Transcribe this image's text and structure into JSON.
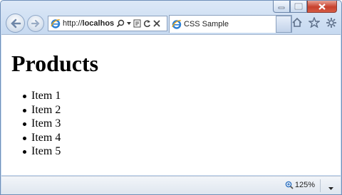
{
  "browser": {
    "address_prefix": "http://",
    "address_host": "localhost:",
    "tab_title": "CSS Sample",
    "zoom_label": "125%"
  },
  "page": {
    "heading": "Products",
    "items": [
      "Item 1",
      "Item 2",
      "Item 3",
      "Item 4",
      "Item 5"
    ]
  },
  "colors": {
    "chrome": "#c6d9f0",
    "close_button": "#c7412d",
    "ie_logo": "#2a7fd4"
  }
}
